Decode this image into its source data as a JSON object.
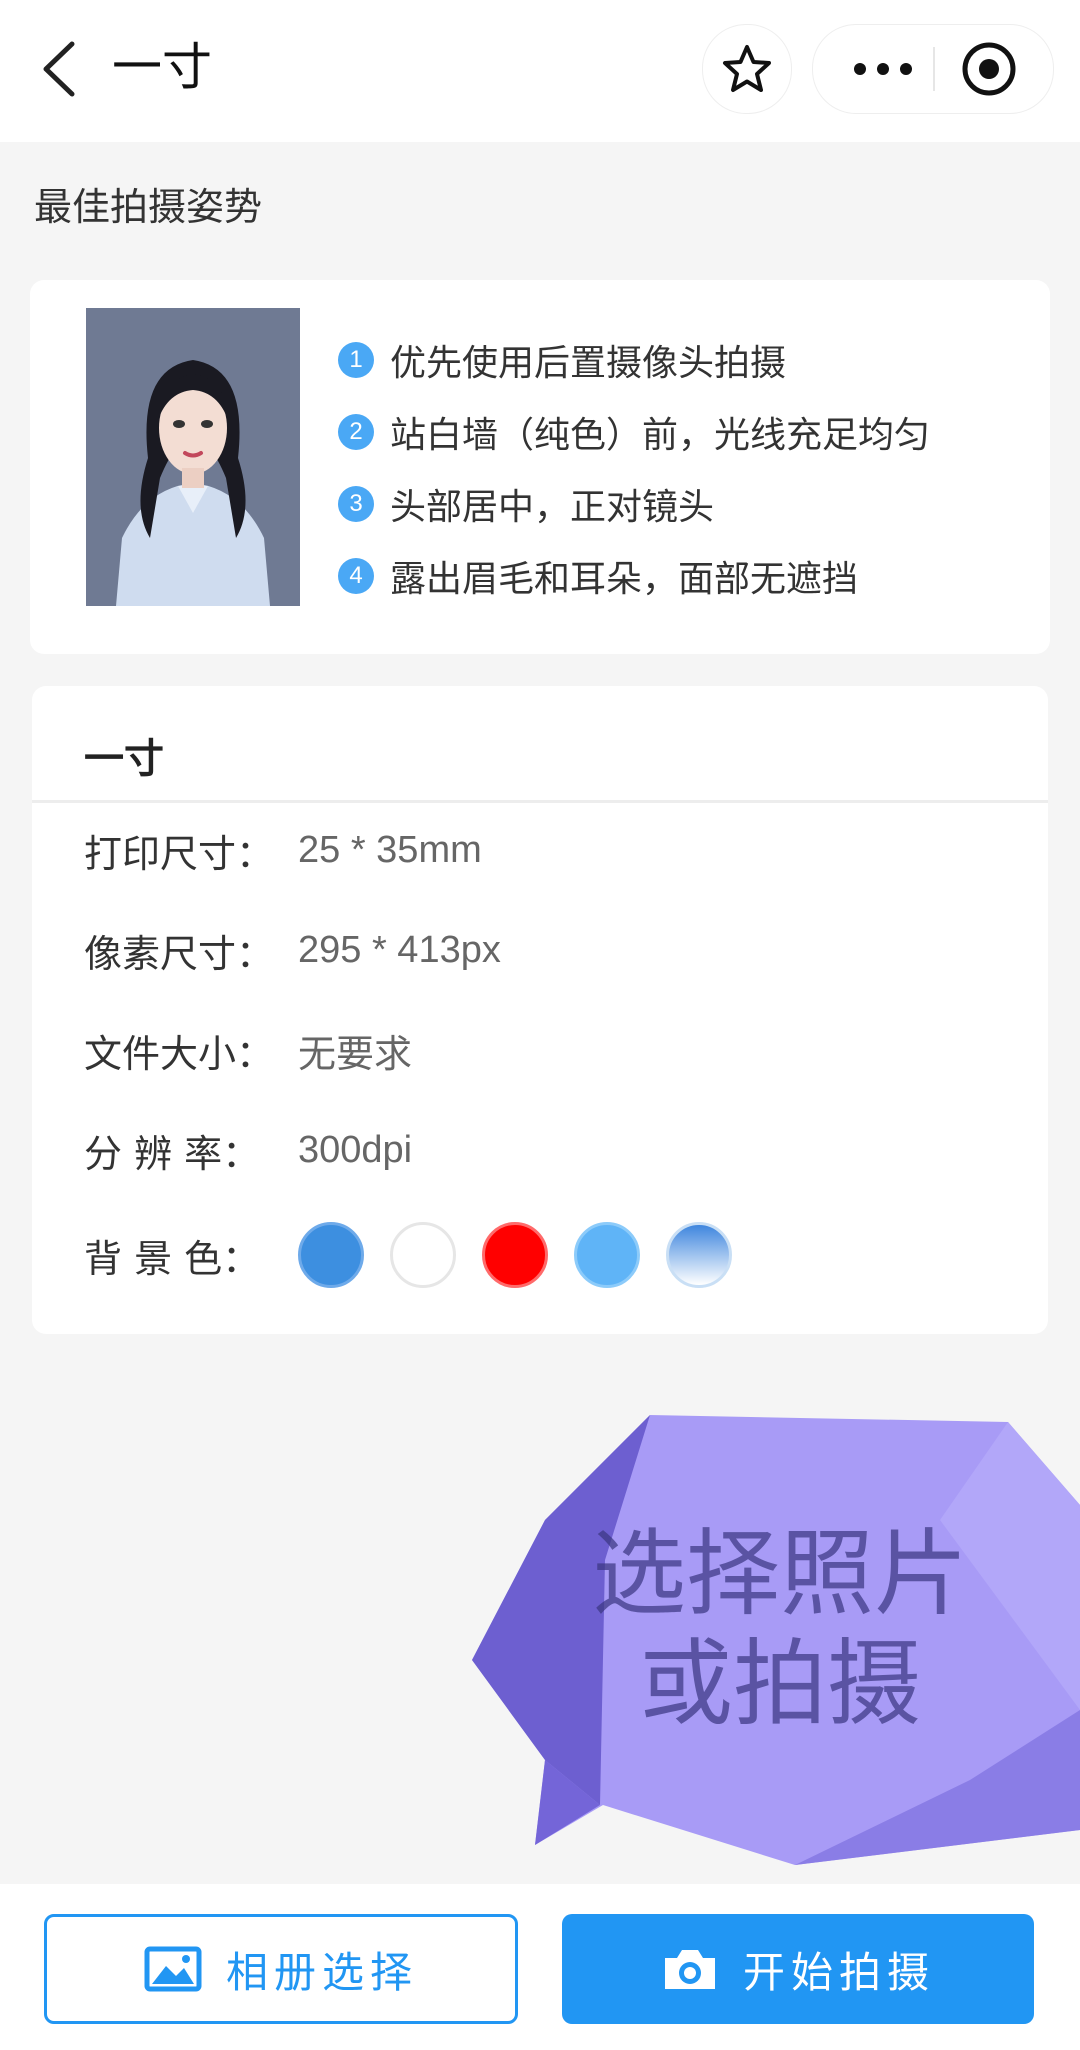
{
  "navbar": {
    "title": "一寸"
  },
  "pose": {
    "section_title": "最佳拍摄姿势",
    "tips": [
      {
        "num": "1",
        "text": "优先使用后置摄像头拍摄"
      },
      {
        "num": "2",
        "text": "站白墙（纯色）前，光线充足均匀"
      },
      {
        "num": "3",
        "text": "头部居中，正对镜头"
      },
      {
        "num": "4",
        "text": "露出眉毛和耳朵，面部无遮挡"
      }
    ]
  },
  "spec": {
    "title": "一寸",
    "print_label": "打印尺寸：",
    "print_value": "25 * 35mm",
    "pixel_label": "像素尺寸：",
    "pixel_value": "295 * 413px",
    "filesize_label": "文件大小：",
    "filesize_value": "无要求",
    "dpi_label": "分 辨 率：",
    "dpi_value": "300dpi",
    "bg_label": "背 景 色：",
    "bg_colors": [
      "#3d8fe0",
      "#ffffff",
      "#ff0000",
      "#5fb4f7",
      "gradient-blue"
    ]
  },
  "bubble": {
    "line1": "选择照片",
    "line2": "或拍摄"
  },
  "bottom": {
    "album_label": "相册选择",
    "shoot_label": "开始拍摄"
  },
  "icons": [
    "back-arrow-icon",
    "star-icon",
    "more-icon",
    "close-circle-icon",
    "image-icon",
    "camera-icon"
  ],
  "colors": {
    "accent": "#2196f3",
    "tip_badge": "#4aa8f5",
    "bubble": "#a895f5"
  }
}
